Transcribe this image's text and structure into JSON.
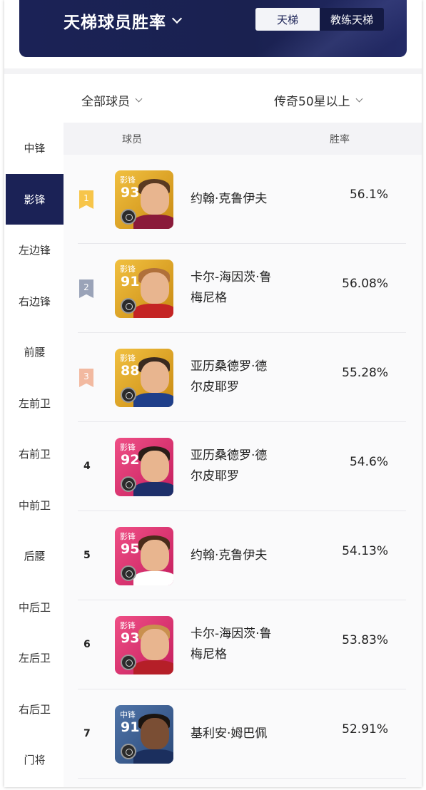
{
  "header": {
    "title": "天梯球员胜率",
    "tabs": [
      {
        "label": "天梯",
        "active": true
      },
      {
        "label": "教练天梯",
        "active": false
      }
    ]
  },
  "filters": {
    "players": "全部球员",
    "tier": "传奇50星以上"
  },
  "sidebar": {
    "items": [
      {
        "label": "中锋",
        "active": false
      },
      {
        "label": "影锋",
        "active": true
      },
      {
        "label": "左边锋",
        "active": false
      },
      {
        "label": "右边锋",
        "active": false
      },
      {
        "label": "前腰",
        "active": false
      },
      {
        "label": "左前卫",
        "active": false
      },
      {
        "label": "右前卫",
        "active": false
      },
      {
        "label": "中前卫",
        "active": false
      },
      {
        "label": "后腰",
        "active": false
      },
      {
        "label": "中后卫",
        "active": false
      },
      {
        "label": "左后卫",
        "active": false
      },
      {
        "label": "右后卫",
        "active": false
      },
      {
        "label": "门将",
        "active": false
      }
    ]
  },
  "table": {
    "columns": {
      "player": "球员",
      "rate": "胜率"
    },
    "rows": [
      {
        "rank": "1",
        "position": "影锋",
        "rating": "93",
        "name_line1": "约翰·克鲁伊夫",
        "name_line2": "",
        "rate": "56.1%",
        "card_style": "gold"
      },
      {
        "rank": "2",
        "position": "影锋",
        "rating": "91",
        "name_line1": "卡尔-海因茨·鲁",
        "name_line2": "梅尼格",
        "rate": "56.08%",
        "card_style": "gold"
      },
      {
        "rank": "3",
        "position": "影锋",
        "rating": "88",
        "name_line1": "亚历桑德罗·德",
        "name_line2": "尔皮耶罗",
        "rate": "55.28%",
        "card_style": "gold"
      },
      {
        "rank": "4",
        "position": "影锋",
        "rating": "92",
        "name_line1": "亚历桑德罗·德",
        "name_line2": "尔皮耶罗",
        "rate": "54.6%",
        "card_style": "pink"
      },
      {
        "rank": "5",
        "position": "影锋",
        "rating": "95",
        "name_line1": "约翰·克鲁伊夫",
        "name_line2": "",
        "rate": "54.13%",
        "card_style": "pink"
      },
      {
        "rank": "6",
        "position": "影锋",
        "rating": "93",
        "name_line1": "卡尔-海因茨·鲁",
        "name_line2": "梅尼格",
        "rate": "53.83%",
        "card_style": "pink"
      },
      {
        "rank": "7",
        "position": "中锋",
        "rating": "91",
        "name_line1": "基利安·姆巴佩",
        "name_line2": "",
        "rate": "52.91%",
        "card_style": "blue"
      }
    ]
  },
  "colors": {
    "navy": "#1b2256",
    "rank1": "#f7c54a",
    "rank2": "#9aa3b8",
    "rank3": "#f2b9a0",
    "gold_card": "#e0a522",
    "pink_card": "#e23a76",
    "blue_card": "#3a5a8c"
  }
}
